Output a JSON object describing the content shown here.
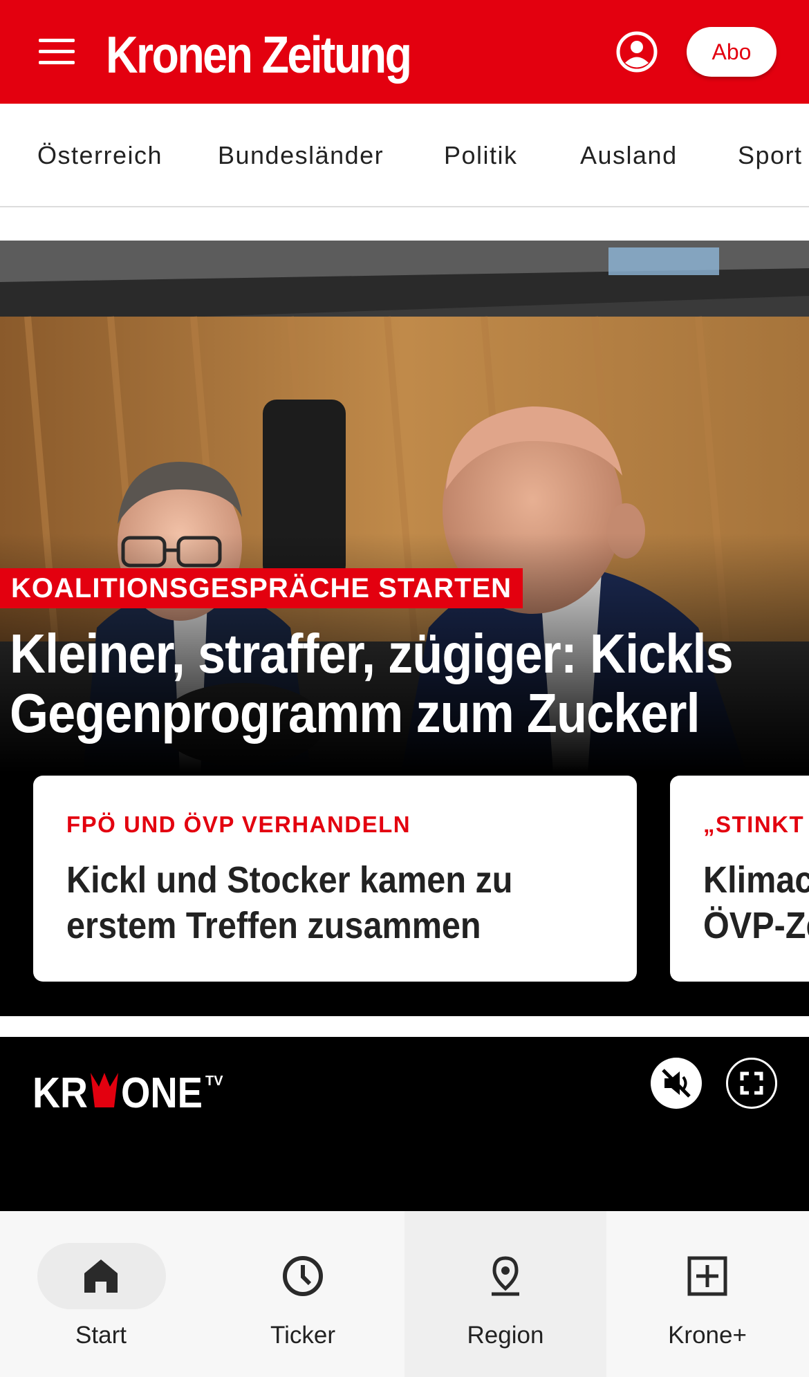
{
  "header": {
    "logo_text": "Kronen Zeitung",
    "abo_label": "Abo",
    "brand_color": "#e3000f"
  },
  "categories": [
    "Österreich",
    "Bundesländer",
    "Politik",
    "Ausland",
    "Sport"
  ],
  "hero": {
    "kicker": "KOALITIONSGESPRÄCHE STARTEN",
    "headline_line1": "Kleiner, straffer, zügiger: Kickls",
    "headline_line2": "Gegenprogramm zum Zuckerl"
  },
  "cards": [
    {
      "kicker": "FPÖ UND ÖVP VERHANDELN",
      "title_line1": "Kickl und Stocker kamen zu",
      "title_line2": "erstem Treffen zusammen"
    },
    {
      "kicker": "„STINKT",
      "title_line1": "Klimac",
      "title_line2": "ÖVP-Ze"
    }
  ],
  "krone_tv": {
    "logo_left": "KR",
    "logo_right": "ONE",
    "logo_sup": "TV",
    "icons": [
      "mute-icon",
      "fullscreen-icon"
    ]
  },
  "bottom_nav": [
    {
      "label": "Start",
      "icon": "home-icon",
      "active": true
    },
    {
      "label": "Ticker",
      "icon": "clock-icon",
      "active": false
    },
    {
      "label": "Region",
      "icon": "location-pin-icon",
      "active": false
    },
    {
      "label": "Krone+",
      "icon": "plus-box-icon",
      "active": false
    }
  ]
}
